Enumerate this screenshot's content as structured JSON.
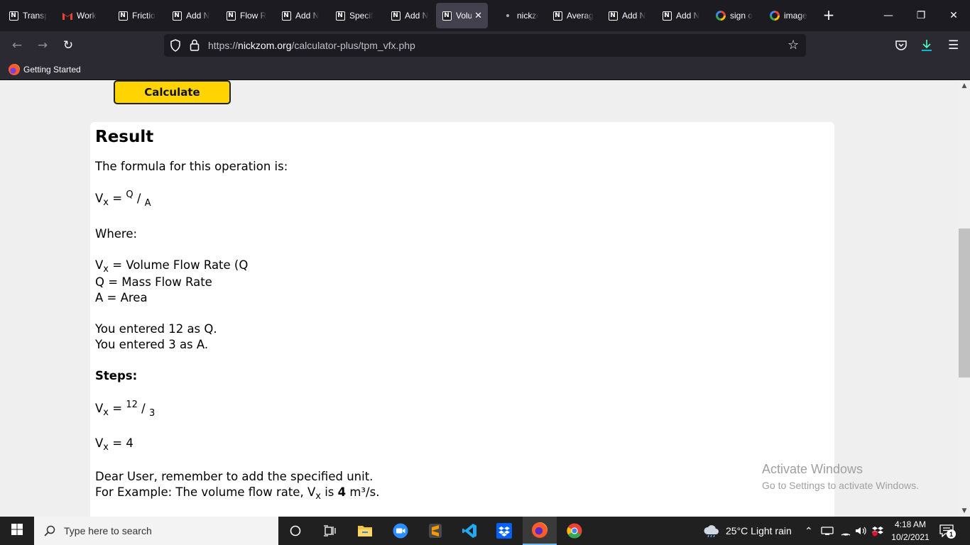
{
  "browser": {
    "tabs": [
      {
        "label": "Transp",
        "icon": "nickzom-icon"
      },
      {
        "label": "Work",
        "icon": "gmail-icon"
      },
      {
        "label": "Frictio",
        "icon": "nickzom-icon"
      },
      {
        "label": "Add N",
        "icon": "nickzom-icon"
      },
      {
        "label": "Flow R",
        "icon": "nickzom-icon"
      },
      {
        "label": "Add N",
        "icon": "nickzom-icon"
      },
      {
        "label": "Specif",
        "icon": "nickzom-icon"
      },
      {
        "label": "Add N",
        "icon": "nickzom-icon"
      },
      {
        "label": "Volu",
        "icon": "nickzom-icon",
        "active": true
      },
      {
        "label": "nickzo",
        "icon": "dot-icon"
      },
      {
        "label": "Averag",
        "icon": "nickzom-icon"
      },
      {
        "label": "Add N",
        "icon": "nickzom-icon"
      },
      {
        "label": "Add N",
        "icon": "nickzom-icon"
      },
      {
        "label": "sign o",
        "icon": "google-icon"
      },
      {
        "label": "image",
        "icon": "google-icon"
      }
    ],
    "url_prefix": "https://",
    "url_domain": "nickzom.org",
    "url_path": "/calculator-plus/tpm_vfx.php",
    "bookmark": "Getting Started"
  },
  "page": {
    "calculate_label": "Calculate",
    "result_title": "Result",
    "formula_intro": "The formula for this operation is:",
    "v": "V",
    "x": "x",
    "eq": " = ",
    "q": "Q",
    "slash": "/",
    "a": "A",
    "where": "Where:",
    "def_v": " = Volume Flow Rate (Q",
    "def_q": "Q = Mass Flow Rate",
    "def_a": "A = Area",
    "entered_q": "You entered 12 as Q.",
    "entered_a": "You entered 3 as A.",
    "steps": "Steps:",
    "num": "12",
    "den": "3",
    "answer": " = 4",
    "reminder": "Dear User, remember to add the specified unit.",
    "example_pre": "For Example: The volume flow rate, V",
    "example_mid": " is ",
    "example_val": "4",
    "example_unit": " m³/s."
  },
  "watermark": {
    "line1": "Activate Windows",
    "line2": "Go to Settings to activate Windows."
  },
  "taskbar": {
    "search_placeholder": "Type here to search",
    "weather": "25°C  Light rain",
    "time": "4:18 AM",
    "date": "10/2/2021",
    "notification_count": "1"
  },
  "colors": {
    "calc_button": "#ffd400",
    "tab_bg": "#1c1b22",
    "toolbar_bg": "#2b2a33"
  }
}
